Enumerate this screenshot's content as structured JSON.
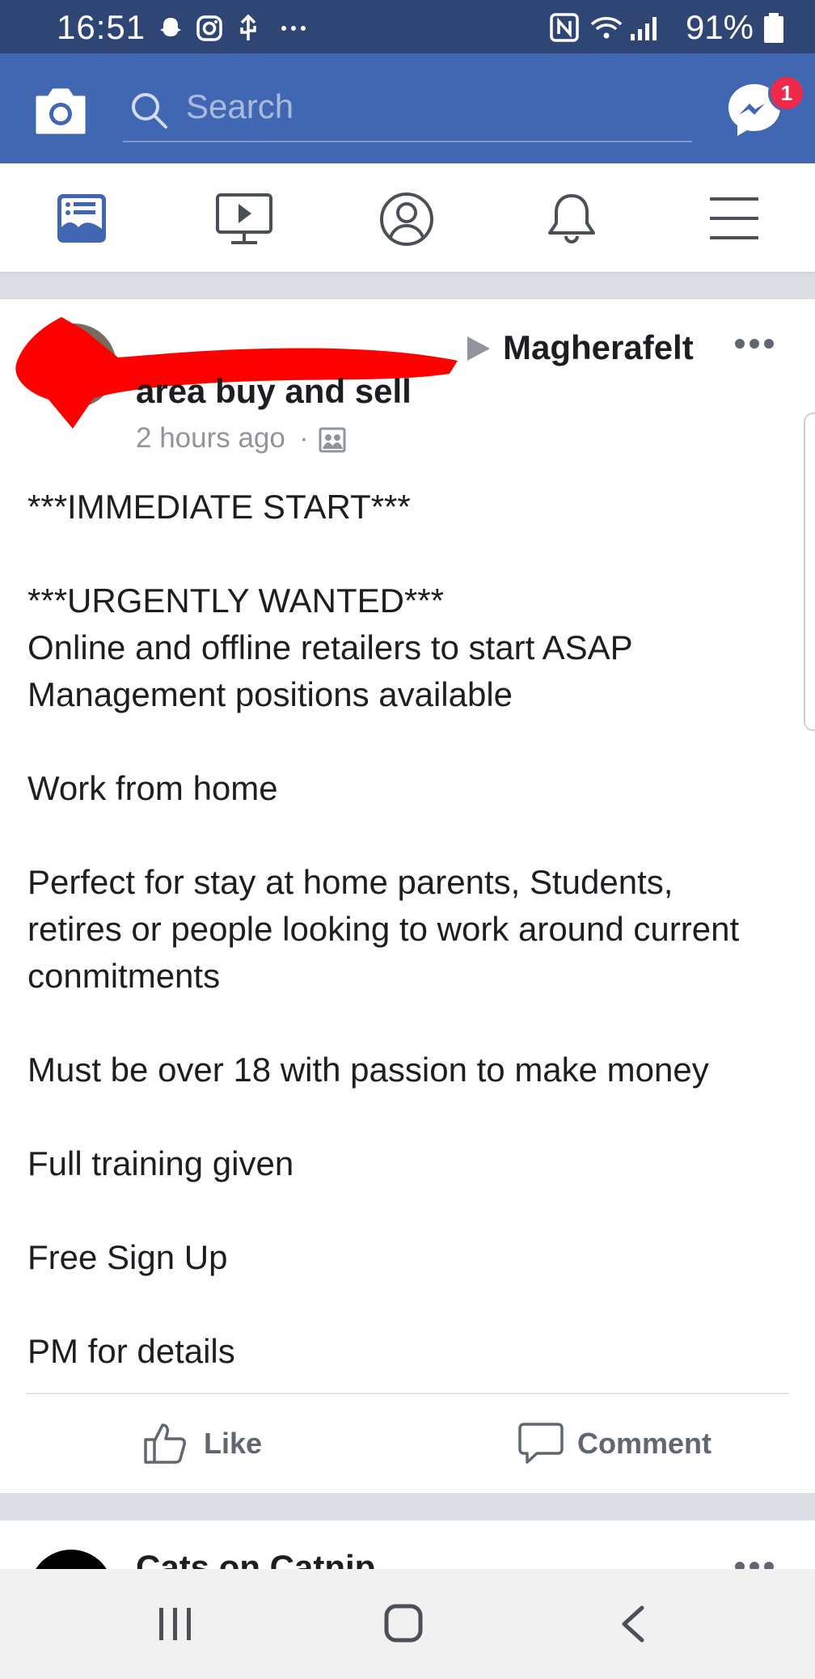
{
  "status_bar": {
    "time": "16:51",
    "battery": "91%",
    "notification_icons": [
      "snapchat-icon",
      "instagram-icon",
      "usb-icon",
      "more-icon"
    ],
    "system_icons": [
      "nfc-icon",
      "wifi-icon",
      "signal-icon",
      "battery-icon"
    ]
  },
  "top_bar": {
    "search_placeholder": "Search",
    "messenger_badge": "1"
  },
  "nav_tabs": [
    {
      "name": "news-feed",
      "icon": "news-feed-icon",
      "active": true
    },
    {
      "name": "watch",
      "icon": "watch-icon"
    },
    {
      "name": "profile",
      "icon": "profile-icon"
    },
    {
      "name": "notifications",
      "icon": "bell-icon"
    },
    {
      "name": "menu",
      "icon": "hamburger-icon"
    }
  ],
  "post": {
    "group_name_line1": "Magherafelt",
    "group_name_line2": "area buy and sell",
    "timestamp": "2 hours ago",
    "body_lines": [
      "***IMMEDIATE START***",
      "",
      "***URGENTLY WANTED***",
      "Online and offline retailers to start ASAP",
      "Management positions available",
      "",
      "Work from home",
      "",
      "Perfect for stay at home parents, Students,",
      "retires or people looking to work around current",
      "conmitments",
      "",
      "Must be over 18 with passion to make money",
      "",
      "Full training given",
      "",
      "Free Sign Up",
      "",
      "PM for details"
    ],
    "like_label": "Like",
    "comment_label": "Comment"
  },
  "next_post": {
    "author": "Cats on Catnip"
  },
  "colors": {
    "facebook_blue": "#4267b2",
    "status_bar": "#2f4574",
    "badge_red": "#f02849",
    "redaction": "#ff0000"
  }
}
